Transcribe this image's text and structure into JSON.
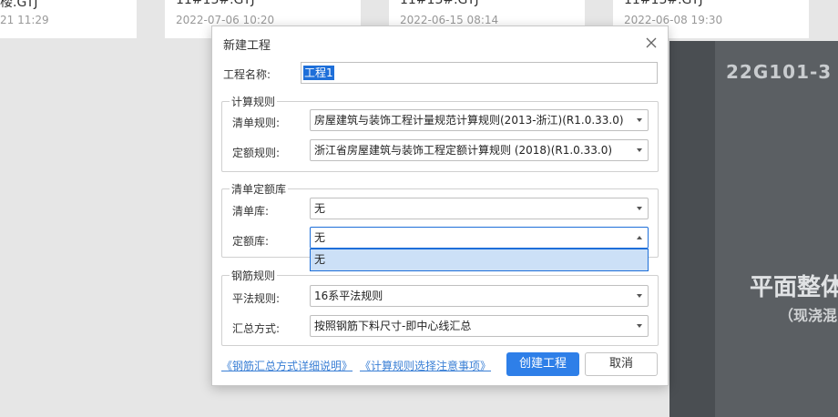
{
  "background": {
    "recent_files": [
      {
        "name": "楼.GTJ",
        "date": "21 11:29"
      },
      {
        "name": "11#13#.GTJ",
        "date": "2022-07-06 10:20"
      },
      {
        "name": "11#13#.GTJ",
        "date": "2022-06-15 08:14"
      },
      {
        "name": "11#13#.GTJ",
        "date": "2022-06-08 19:30"
      }
    ],
    "book": {
      "code": "22G101-3",
      "title_line1": "平面整体表",
      "title_line2": "（现浇混"
    }
  },
  "dialog": {
    "title": "新建工程",
    "project_name": {
      "label": "工程名称:",
      "value": "工程1"
    },
    "calc_rules": {
      "legend": "计算规则",
      "bill_rule": {
        "label": "清单规则:",
        "value": "房屋建筑与装饰工程计量规范计算规则(2013-浙江)(R1.0.33.0)"
      },
      "quota_rule": {
        "label": "定额规则:",
        "value": "浙江省房屋建筑与装饰工程定额计算规则 (2018)(R1.0.33.0)"
      }
    },
    "libraries": {
      "legend": "清单定额库",
      "bill_lib": {
        "label": "清单库:",
        "value": "无"
      },
      "quota_lib": {
        "label": "定额库:",
        "value": "无"
      },
      "quota_lib_options": [
        "无"
      ]
    },
    "rebar_rules": {
      "legend": "钢筋规则",
      "flat_rule": {
        "label": "平法规则:",
        "value": "16系平法规则"
      },
      "summary_mode": {
        "label": "汇总方式:",
        "value": "按照钢筋下料尺寸-即中心线汇总"
      }
    },
    "links": {
      "rebar_summary_help": "《钢筋汇总方式详细说明》",
      "calc_rule_help": "《计算规则选择注意事项》"
    },
    "buttons": {
      "create": "创建工程",
      "cancel": "取消"
    }
  }
}
